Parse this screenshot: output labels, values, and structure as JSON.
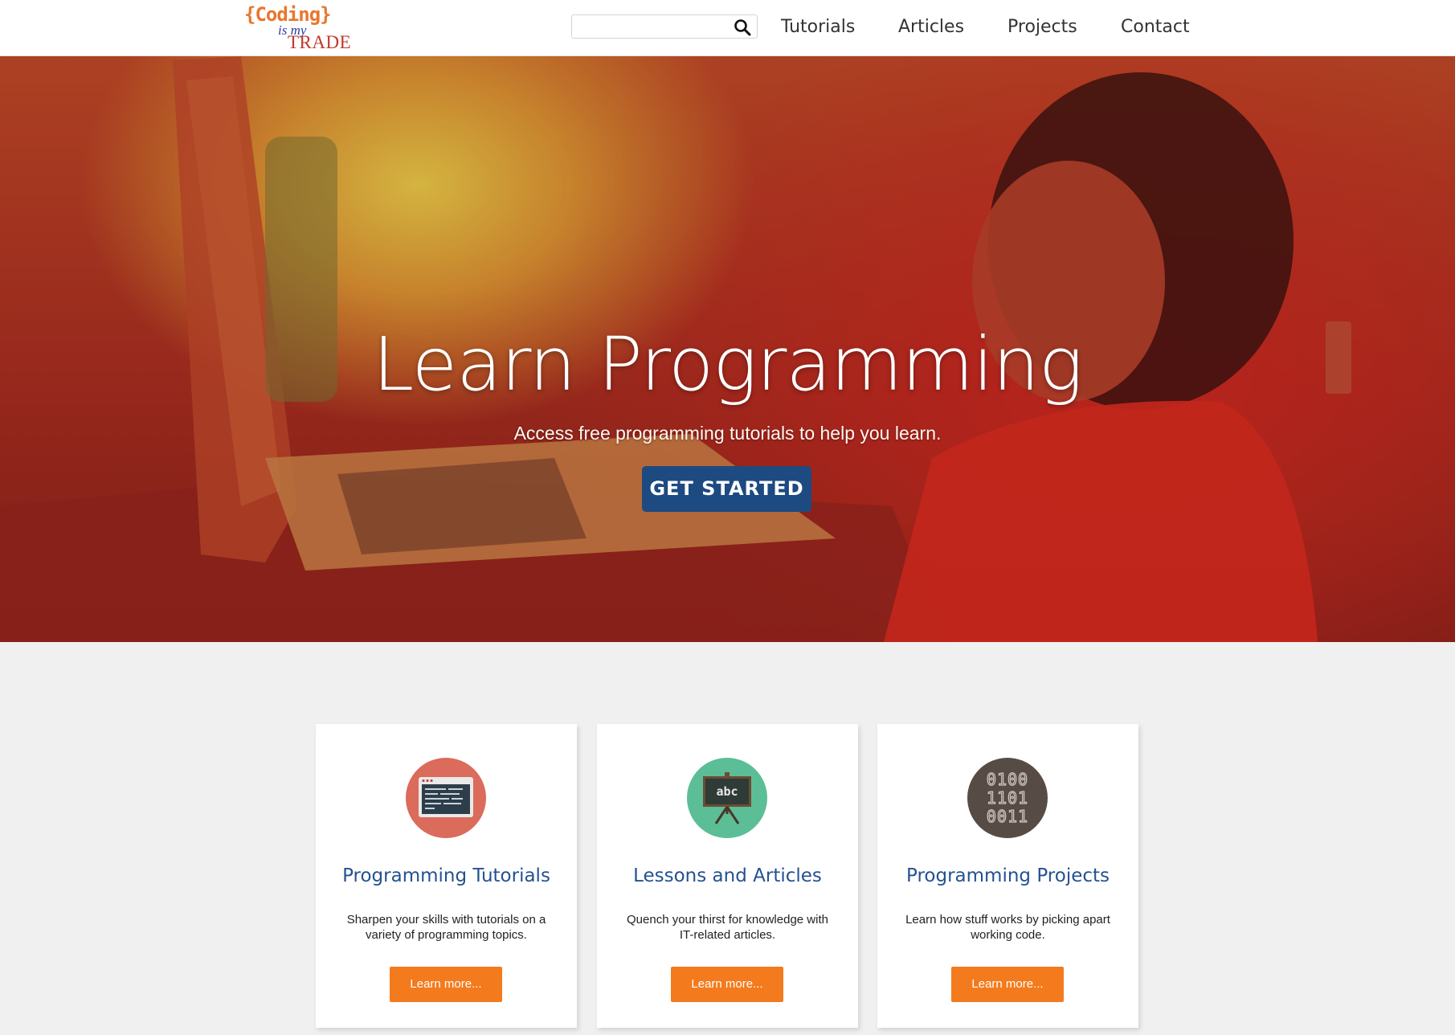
{
  "logo": {
    "line1": "{Coding}",
    "line2": "is my",
    "line3": "TRADE"
  },
  "search": {
    "value": "",
    "placeholder": ""
  },
  "nav": {
    "items": [
      "Tutorials",
      "Articles",
      "Projects",
      "Contact"
    ]
  },
  "hero": {
    "title": "Learn Programming",
    "subtitle": "Access free programming tutorials to help you learn.",
    "cta_label": "GET STARTED"
  },
  "cards": [
    {
      "icon": "terminal-window-icon",
      "icon_color": "#db6b5a",
      "title": "Programming Tutorials",
      "text": "Sharpen your skills with tutorials on a variety of programming topics.",
      "button": "Learn more..."
    },
    {
      "icon": "chalkboard-icon",
      "icon_color": "#5bbe97",
      "title": "Lessons and Articles",
      "text": "Quench your thirst for knowledge with IT-related articles.",
      "button": "Learn more...",
      "board_text": "abc"
    },
    {
      "icon": "binary-code-icon",
      "icon_color": "#574c45",
      "title": "Programming Projects",
      "text": "Learn how stuff works by picking apart working code.",
      "button": "Learn more...",
      "binary_rows": [
        "0100",
        "1101",
        "0011"
      ]
    }
  ],
  "colors": {
    "accent_orange": "#f37b1d",
    "primary_blue": "#1d4a80",
    "heading_blue": "#24528f"
  }
}
